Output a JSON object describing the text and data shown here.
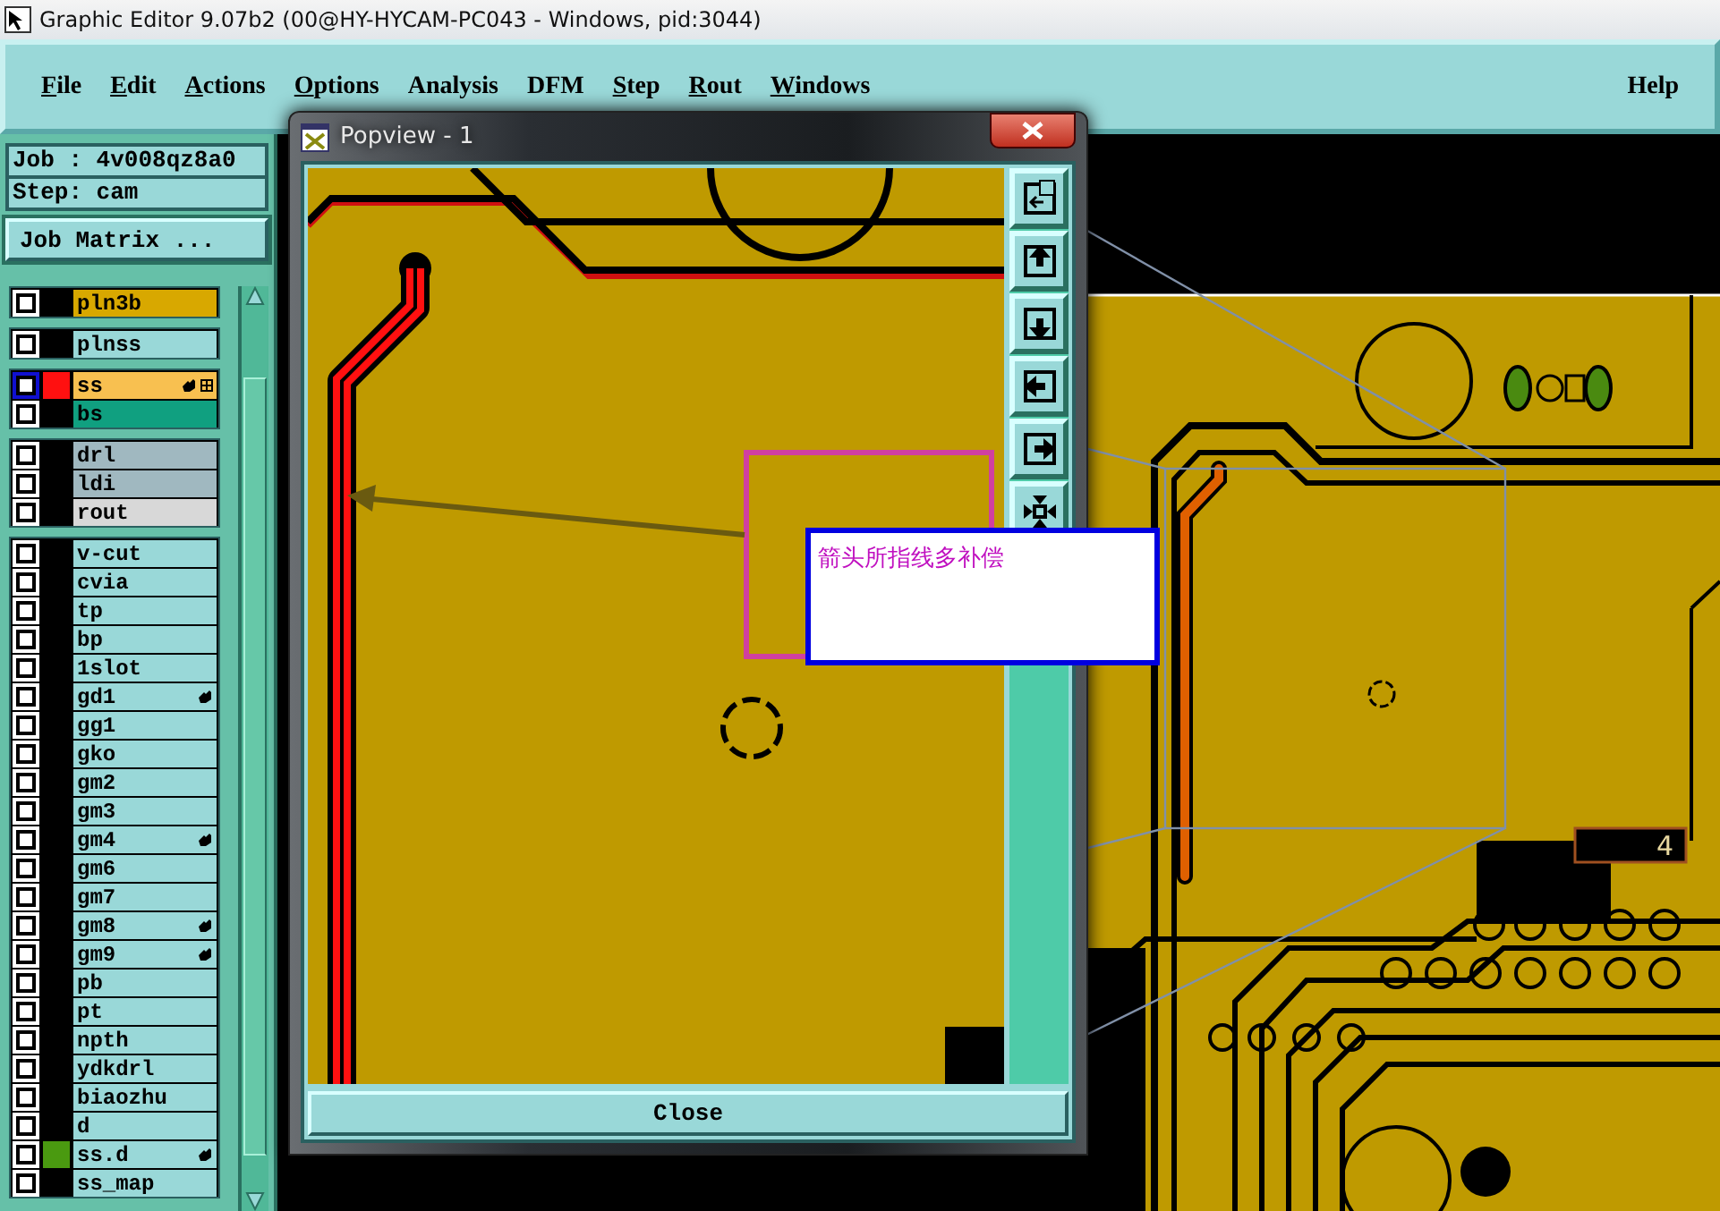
{
  "window": {
    "title": "Graphic Editor 9.07b2 (00@HY-HYCAM-PC043 - Windows, pid:3044)"
  },
  "menu": [
    {
      "label": "File",
      "mnemonic": true
    },
    {
      "label": "Edit",
      "mnemonic": true
    },
    {
      "label": "Actions",
      "mnemonic": true
    },
    {
      "label": "Options",
      "mnemonic": true
    },
    {
      "label": "Analysis",
      "mnemonic": false
    },
    {
      "label": "DFM",
      "mnemonic": false
    },
    {
      "label": "Step",
      "mnemonic": true
    },
    {
      "label": "Rout",
      "mnemonic": true
    },
    {
      "label": "Windows",
      "mnemonic": true
    }
  ],
  "help": {
    "label": "Help"
  },
  "job": {
    "job_label": "Job : 4v008qz8a0",
    "step_label": "Step: cam",
    "matrix_button": "Job Matrix ..."
  },
  "layer_groups": [
    {
      "layers": [
        {
          "name": "pln3b",
          "color": "#d8a800",
          "selected": false,
          "affected": false,
          "work": false
        }
      ]
    },
    {
      "layers": [
        {
          "name": "plnss",
          "color": "#99d8d8",
          "selected": false,
          "affected": false,
          "work": false
        }
      ]
    },
    {
      "layers": [
        {
          "name": "ss",
          "color": "#f8c050",
          "swatch": {
            "color": "#ff1010"
          },
          "selected": true,
          "affected": true,
          "work": true
        },
        {
          "name": "bs",
          "color": "#10a080",
          "selected": false,
          "affected": false,
          "work": false
        }
      ]
    },
    {
      "layers": [
        {
          "name": "drl",
          "color": "#a0b8c0",
          "selected": false,
          "affected": false,
          "work": false
        },
        {
          "name": "ldi",
          "color": "#a0b8c0",
          "selected": false,
          "affected": false,
          "work": false
        },
        {
          "name": "rout",
          "color": "#d8d8d8",
          "selected": false,
          "affected": false,
          "work": false
        }
      ]
    },
    {
      "layers": [
        {
          "name": "v-cut",
          "color": "#99d8d8",
          "selected": false,
          "affected": false,
          "work": false
        },
        {
          "name": "cvia",
          "color": "#99d8d8",
          "selected": false,
          "affected": false,
          "work": false
        },
        {
          "name": "tp",
          "color": "#99d8d8",
          "selected": false,
          "affected": false,
          "work": false
        },
        {
          "name": "bp",
          "color": "#99d8d8",
          "selected": false,
          "affected": false,
          "work": false
        },
        {
          "name": "1slot",
          "color": "#99d8d8",
          "selected": false,
          "affected": false,
          "work": false
        },
        {
          "name": "gd1",
          "color": "#99d8d8",
          "selected": false,
          "affected": true,
          "work": false
        },
        {
          "name": "gg1",
          "color": "#99d8d8",
          "selected": false,
          "affected": false,
          "work": false
        },
        {
          "name": "gko",
          "color": "#99d8d8",
          "selected": false,
          "affected": false,
          "work": false
        },
        {
          "name": "gm2",
          "color": "#99d8d8",
          "selected": false,
          "affected": false,
          "work": false
        },
        {
          "name": "gm3",
          "color": "#99d8d8",
          "selected": false,
          "affected": false,
          "work": false
        },
        {
          "name": "gm4",
          "color": "#99d8d8",
          "selected": false,
          "affected": true,
          "work": false
        },
        {
          "name": "gm6",
          "color": "#99d8d8",
          "selected": false,
          "affected": false,
          "work": false
        },
        {
          "name": "gm7",
          "color": "#99d8d8",
          "selected": false,
          "affected": false,
          "work": false
        },
        {
          "name": "gm8",
          "color": "#99d8d8",
          "selected": false,
          "affected": true,
          "work": false
        },
        {
          "name": "gm9",
          "color": "#99d8d8",
          "selected": false,
          "affected": true,
          "work": false
        },
        {
          "name": "pb",
          "color": "#99d8d8",
          "selected": false,
          "affected": false,
          "work": false
        },
        {
          "name": "pt",
          "color": "#99d8d8",
          "selected": false,
          "affected": false,
          "work": false
        },
        {
          "name": "npth",
          "color": "#99d8d8",
          "selected": false,
          "affected": false,
          "work": false
        },
        {
          "name": "ydkdrl",
          "color": "#99d8d8",
          "selected": false,
          "affected": false,
          "work": false
        },
        {
          "name": "biaozhu",
          "color": "#99d8d8",
          "selected": false,
          "affected": false,
          "work": false
        },
        {
          "name": "d",
          "color": "#99d8d8",
          "selected": false,
          "affected": false,
          "work": false
        },
        {
          "name": "ss.d",
          "color": "#99d8d8",
          "swatch": {
            "color": "#4a9a10"
          },
          "selected": false,
          "affected": true,
          "work": false
        },
        {
          "name": "ss_map",
          "color": "#99d8d8",
          "selected": false,
          "affected": false,
          "work": false
        }
      ]
    }
  ],
  "popview": {
    "title": "Popview - 1",
    "tools": [
      {
        "kind": "fit"
      },
      {
        "kind": "up"
      },
      {
        "kind": "down"
      },
      {
        "kind": "left"
      },
      {
        "kind": "right"
      },
      {
        "kind": "zoom"
      }
    ],
    "close_button": "Close"
  },
  "annotation": {
    "text": "箭头所指线多补偿"
  },
  "board": {
    "marking": "4"
  }
}
